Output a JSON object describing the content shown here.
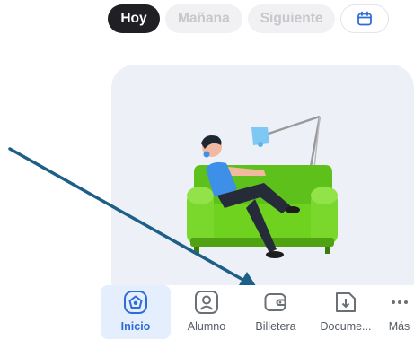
{
  "date_filter": {
    "today": "Hoy",
    "tomorrow": "Mañana",
    "next": "Siguiente",
    "calendar_icon": "calendar-icon"
  },
  "colors": {
    "active_chip": "#1f1f24",
    "accent_blue": "#2f6bd9",
    "couch_green": "#6fd21e",
    "arrow": "#1d5f86"
  },
  "bottom_nav": {
    "items": [
      {
        "label": "Inicio",
        "icon": "home-icon",
        "active": true
      },
      {
        "label": "Alumno",
        "icon": "student-icon",
        "active": false
      },
      {
        "label": "Billetera",
        "icon": "wallet-icon",
        "active": false
      },
      {
        "label": "Docume...",
        "icon": "document-download-icon",
        "active": false
      },
      {
        "label": "Más",
        "icon": "more-icon",
        "active": false
      }
    ]
  }
}
